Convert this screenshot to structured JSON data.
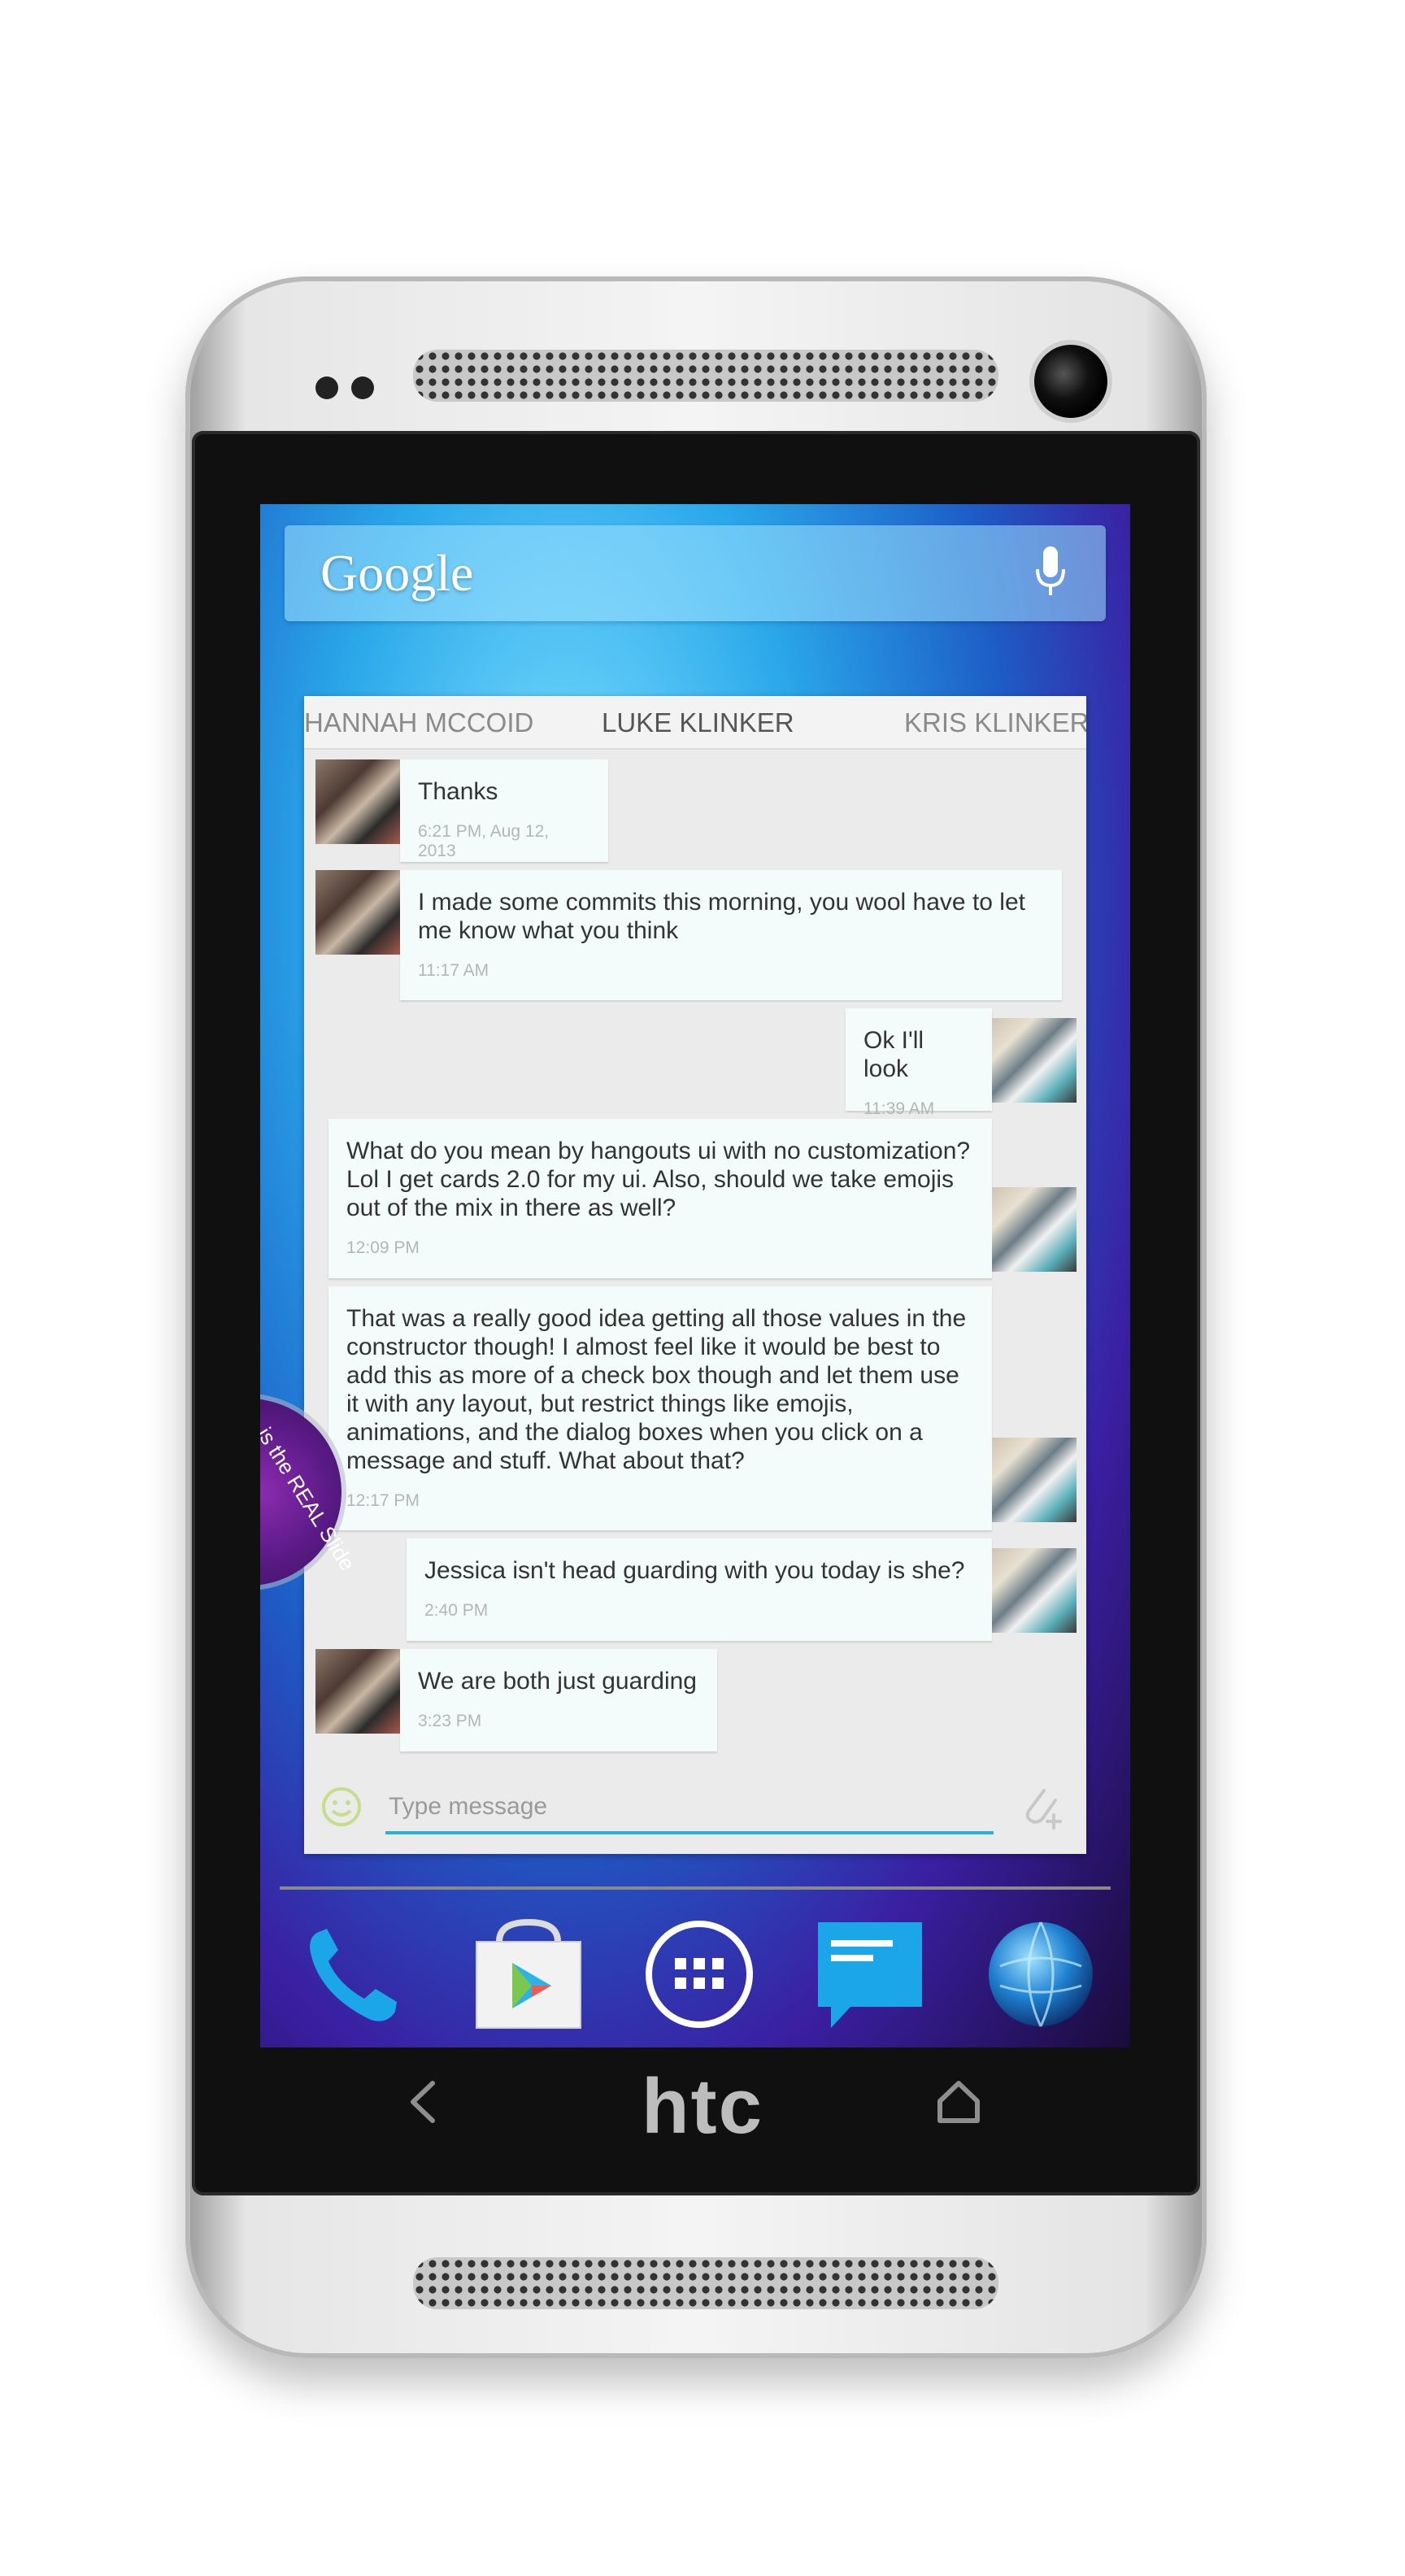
{
  "search": {
    "logo": "Google"
  },
  "tabs": [
    "HANNAH MCCOID",
    "LUKE KLINKER",
    "KRIS KLINKER"
  ],
  "messages": [
    {
      "text": "Thanks",
      "time": "6:21 PM, Aug 12, 2013"
    },
    {
      "text": "I made some commits this morning, you wool have to let me know what you think",
      "time": "11:17 AM"
    },
    {
      "text": "Ok I'll look",
      "time": "11:39 AM"
    },
    {
      "text": "What do you mean by hangouts ui with no customization? Lol I get cards 2.0 for my ui. Also, should we take emojis out of the mix in there as well?",
      "time": "12:09 PM"
    },
    {
      "text": "That was a really good idea getting all those values in the constructor though! I almost feel like it would be best to add this as more of a check box though and let them use it with any layout, but restrict things like emojis, animations, and the dialog boxes when you click on a message and stuff. What about that?",
      "time": "12:17 PM"
    },
    {
      "text": "Jessica isn't head guarding with you today is she?",
      "time": "2:40 PM"
    },
    {
      "text": "We are both just guarding",
      "time": "3:23 PM"
    }
  ],
  "composer": {
    "placeholder": "Type message"
  },
  "slider": {
    "text": "is the REAL Slide"
  },
  "brand": "htc",
  "icons": {
    "mic": "microphone-icon",
    "emoji": "emoji-icon",
    "attach": "attach-icon",
    "phone": "phone-icon",
    "store": "play-store-icon",
    "drawer": "app-drawer-icon",
    "messaging": "messaging-icon",
    "browser": "browser-icon",
    "back": "back-icon",
    "home": "home-icon"
  },
  "colors": {
    "accent": "#2ab0d6",
    "bubble": "#f3fcfa",
    "card": "#ebebeb"
  }
}
